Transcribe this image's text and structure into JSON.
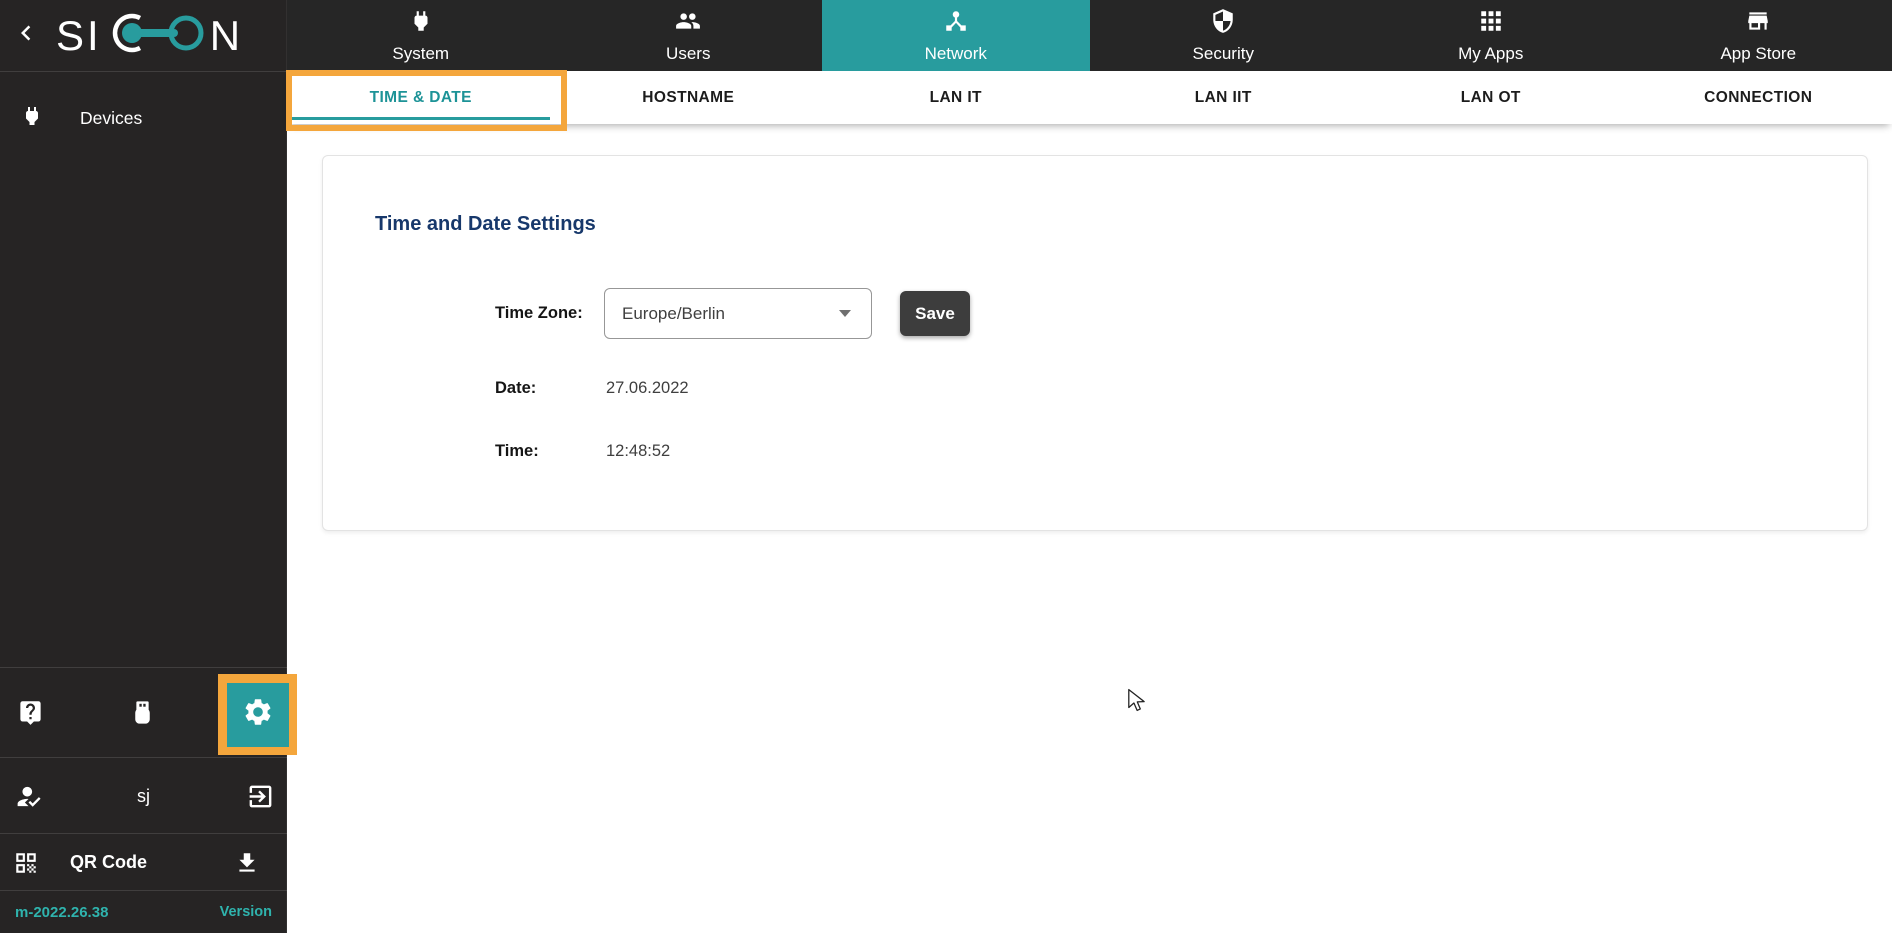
{
  "colors": {
    "teal": "#289C9E",
    "teal_text_active": "#1D9397",
    "teal_version": "#2FB3AD",
    "orange_highlight": "#F4A63C",
    "dark_bar": "#262424",
    "navy_heading": "#17386B",
    "save_button": "#3D3D3D"
  },
  "sidebar": {
    "brand_left": "SI",
    "brand_right": "N",
    "devices_label": "Devices",
    "username": "sj",
    "qr_label": "QR Code",
    "version_value": "m-2022.26.38",
    "version_label": "Version"
  },
  "topnav": {
    "active": "Network",
    "tabs": [
      {
        "label": "System",
        "icon": "power-plug-icon"
      },
      {
        "label": "Users",
        "icon": "users-icon"
      },
      {
        "label": "Network",
        "icon": "network-hub-icon"
      },
      {
        "label": "Security",
        "icon": "shield-icon"
      },
      {
        "label": "My Apps",
        "icon": "apps-grid-icon"
      },
      {
        "label": "App Store",
        "icon": "storefront-icon"
      }
    ]
  },
  "subnav": {
    "active": "TIME & DATE",
    "tabs": [
      {
        "label": "TIME & DATE"
      },
      {
        "label": "HOSTNAME"
      },
      {
        "label": "LAN IT"
      },
      {
        "label": "LAN IIT"
      },
      {
        "label": "LAN OT"
      },
      {
        "label": "CONNECTION"
      }
    ]
  },
  "panel": {
    "title": "Time and Date Settings",
    "timezone": {
      "label": "Time Zone:",
      "value": "Europe/Berlin"
    },
    "save_label": "Save",
    "date": {
      "label": "Date:",
      "value": "27.06.2022"
    },
    "time": {
      "label": "Time:",
      "value": "12:48:52"
    }
  }
}
